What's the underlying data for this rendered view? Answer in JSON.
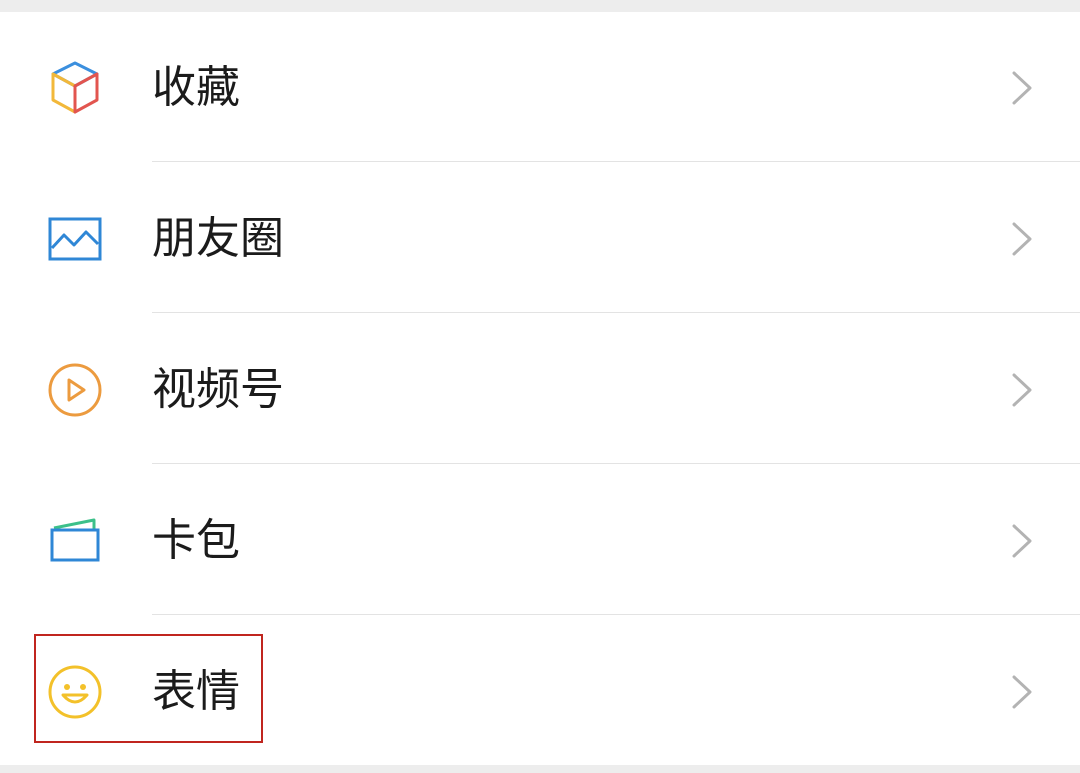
{
  "menu": {
    "items": [
      {
        "label": "收藏",
        "icon": "favorites-cube-icon",
        "colors": [
          "#3b8fde",
          "#f2b83a",
          "#e2554f"
        ]
      },
      {
        "label": "朋友圈",
        "icon": "moments-picture-icon",
        "colors": [
          "#2f87d6"
        ]
      },
      {
        "label": "视频号",
        "icon": "channels-play-icon",
        "colors": [
          "#ec9b3f"
        ]
      },
      {
        "label": "卡包",
        "icon": "card-wallet-icon",
        "colors": [
          "#2f87d6",
          "#3cc08a"
        ]
      },
      {
        "label": "表情",
        "icon": "sticker-smile-icon",
        "colors": [
          "#f3c12a"
        ]
      }
    ]
  },
  "highlight": {
    "color": "#c0251f",
    "target": "menu-item-stickers"
  }
}
